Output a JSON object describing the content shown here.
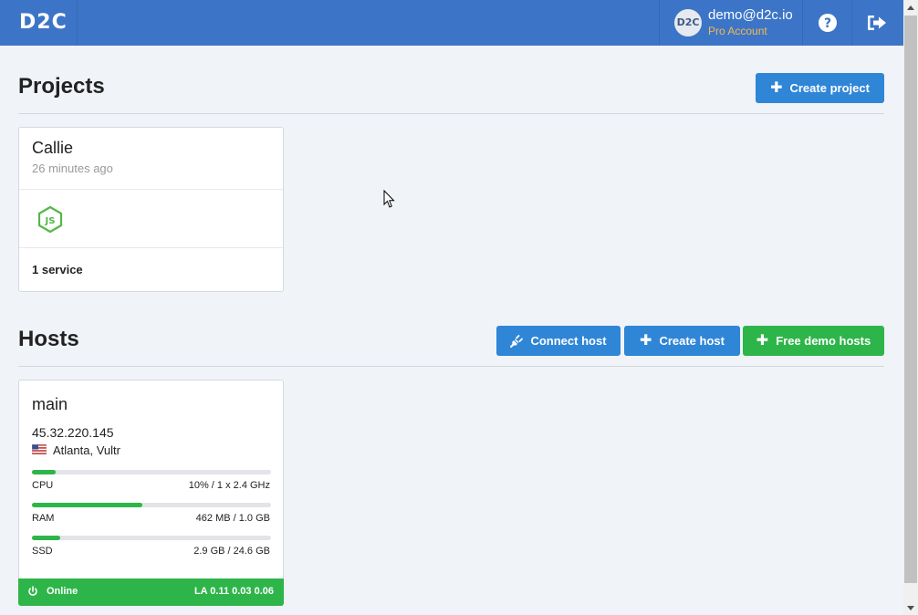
{
  "header": {
    "logo": "D2C",
    "avatar_text": "D2C",
    "user_email": "demo@d2c.io",
    "account_type": "Pro Account",
    "help_icon": "question-circle-icon",
    "logout_icon": "sign-out-icon"
  },
  "projects": {
    "title": "Projects",
    "create_button": "Create project",
    "items": [
      {
        "name": "Callie",
        "updated": "26 minutes ago",
        "icon": "nodejs-icon",
        "services": "1 service"
      }
    ]
  },
  "hosts": {
    "title": "Hosts",
    "buttons": {
      "connect": "Connect host",
      "create": "Create host",
      "free_demo": "Free demo hosts"
    },
    "items": [
      {
        "name": "main",
        "ip": "45.32.220.145",
        "location": "Atlanta, Vultr",
        "flag": "us-flag-icon",
        "cpu_label": "CPU",
        "cpu_value": "10% / 1 x 2.4 GHz",
        "cpu_percent": 10,
        "ram_label": "RAM",
        "ram_value": "462 MB / 1.0 GB",
        "ram_percent": 46,
        "ssd_label": "SSD",
        "ssd_value": "2.9 GB / 24.6 GB",
        "ssd_percent": 12,
        "status": "Online",
        "load_average": "LA 0.11 0.03 0.06"
      }
    ]
  },
  "colors": {
    "header_bg": "#3c75c7",
    "accent_orange": "#f5b94f",
    "primary_blue": "#2f86d6",
    "success_green": "#2eb54a",
    "node_green": "#54b848"
  }
}
